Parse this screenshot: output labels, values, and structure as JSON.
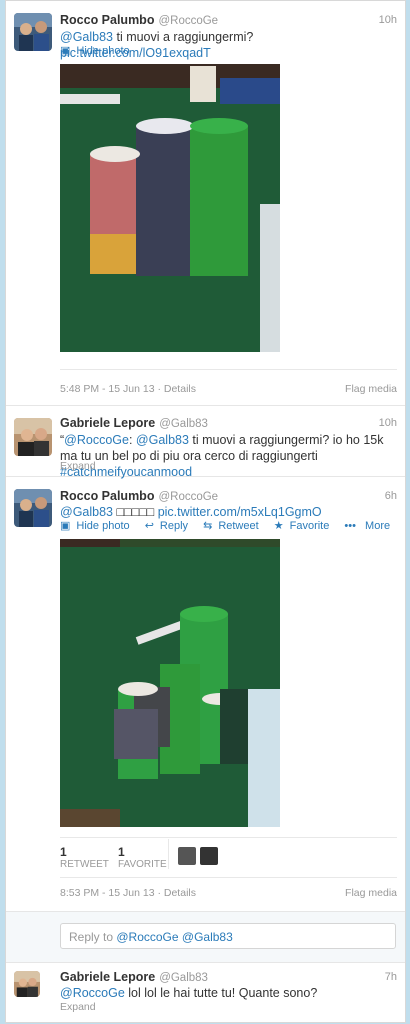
{
  "tweets": [
    {
      "name": "Rocco Palumbo",
      "handle": "@RoccoGe",
      "time": "10h",
      "mention": "@Galb83",
      "text": " ti muovi a raggiungermi? ",
      "link": "pic.twitter.com/lO91exqadT",
      "hide_photo": "Hide photo",
      "meta": "5:48 PM - 15 Jun 13 · Details",
      "flag": "Flag media"
    },
    {
      "name": "Gabriele Lepore",
      "handle": "@Galb83",
      "time": "10h",
      "quote_open": "“",
      "mention1": "@RoccoGe",
      "colon": ": ",
      "mention2": "@Galb83",
      "text": " ti muovi a raggiungermi? io ho 15k ma tu un bel po di piu ora cerco di raggiungerti ",
      "hashtag": "#catchmeifyoucanmood",
      "expand": "Expand"
    },
    {
      "name": "Rocco Palumbo",
      "handle": "@RoccoGe",
      "time": "6h",
      "mention": "@Galb83",
      "text": " □□□□□ ",
      "link": "pic.twitter.com/m5xLq1GgmO",
      "actions": {
        "hide_photo": "Hide photo",
        "reply": "Reply",
        "retweet": "Retweet",
        "favorite": "Favorite",
        "more": "More"
      },
      "retweets": {
        "count": "1",
        "label": "RETWEET"
      },
      "favorites": {
        "count": "1",
        "label": "FAVORITE"
      },
      "meta": "8:53 PM - 15 Jun 13 · Details",
      "flag": "Flag media",
      "reply_placeholder": "Reply to ",
      "reply_mention1": "@RoccoGe",
      "reply_mention2": "@Galb83"
    },
    {
      "name": "Gabriele Lepore",
      "handle": "@Galb83",
      "time": "7h",
      "mention": "@RoccoGe",
      "text": " lol lol le hai tutte tu! Quante sono?",
      "expand": "Expand"
    }
  ],
  "colors": {
    "link": "#2b7bb9",
    "background": "#c0deed",
    "felt": "#1f5b37"
  }
}
